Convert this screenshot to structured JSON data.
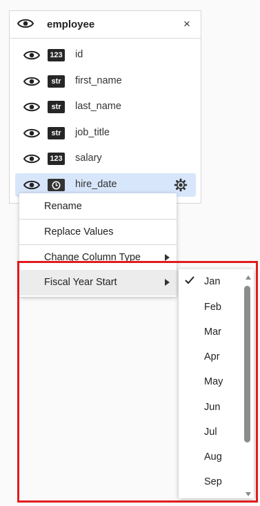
{
  "panel": {
    "title": "employee",
    "close_label": "×",
    "columns": [
      {
        "name": "id",
        "type": "123"
      },
      {
        "name": "first_name",
        "type": "str"
      },
      {
        "name": "last_name",
        "type": "str"
      },
      {
        "name": "job_title",
        "type": "str"
      },
      {
        "name": "salary",
        "type": "123"
      },
      {
        "name": "hire_date",
        "type": "clock",
        "selected": true
      }
    ]
  },
  "context_menu": {
    "items": [
      {
        "label": "Rename"
      },
      {
        "label": "Replace Values"
      },
      {
        "label": "Change Column Type",
        "has_submenu": true
      },
      {
        "label": "Fiscal Year Start",
        "has_submenu": true,
        "active": true
      }
    ]
  },
  "fiscal_submenu": {
    "selected": "Jan",
    "months": [
      "Jan",
      "Feb",
      "Mar",
      "Apr",
      "May",
      "Jun",
      "Jul",
      "Aug",
      "Sep"
    ]
  },
  "colors": {
    "selected_row": "#d8e6fb",
    "highlight_border": "#e01b1b"
  }
}
